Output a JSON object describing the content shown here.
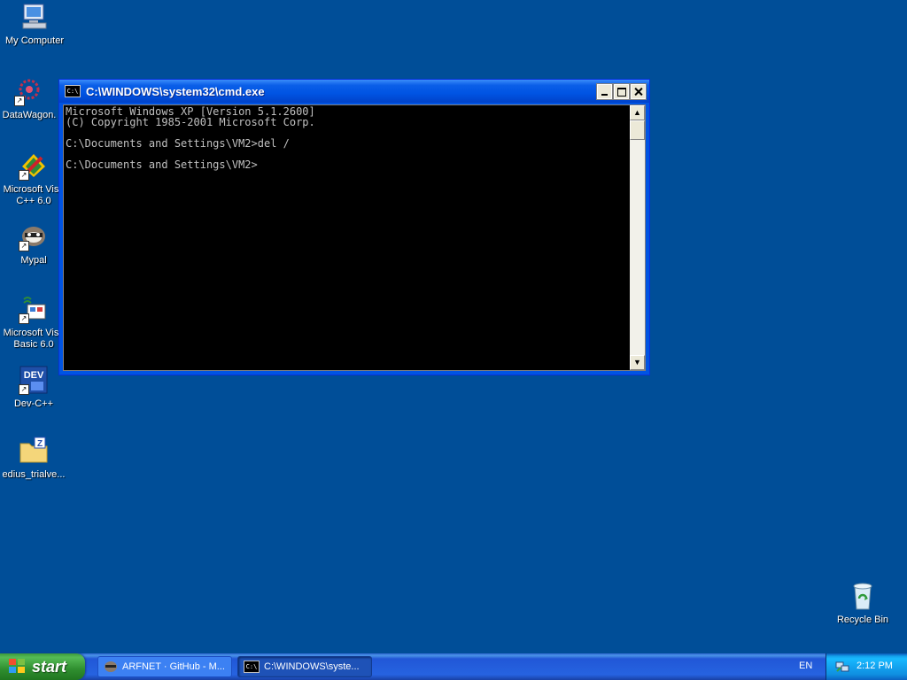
{
  "desktop": {
    "icons": [
      {
        "label": "My Computer",
        "icon": "my-computer-icon"
      },
      {
        "label": "DataWagon.",
        "icon": "datawagon-icon"
      },
      {
        "label": "Microsoft Visu\nC++ 6.0",
        "icon": "visual-cpp-icon"
      },
      {
        "label": "Mypal",
        "icon": "mypal-icon"
      },
      {
        "label": "Microsoft Visu\nBasic 6.0",
        "icon": "visual-basic-icon"
      },
      {
        "label": "Dev-C++",
        "icon": "dev-cpp-icon"
      },
      {
        "label": "edius_trialve...",
        "icon": "zip-folder-icon"
      },
      {
        "label": "Recycle Bin",
        "icon": "recycle-bin-icon"
      }
    ],
    "background": "#004e98"
  },
  "window": {
    "title": "C:\\WINDOWS\\system32\\cmd.exe",
    "icon_text": "C:\\",
    "console_lines": [
      "Microsoft Windows XP [Version 5.1.2600]",
      "(C) Copyright 1985-2001 Microsoft Corp.",
      "",
      "C:\\Documents and Settings\\VM2>del /",
      "",
      "C:\\Documents and Settings\\VM2>"
    ]
  },
  "taskbar": {
    "start_label": "start",
    "tasks": [
      {
        "label": "ARFNET · GitHub - M...",
        "icon": "mypal-icon"
      },
      {
        "label": "C:\\WINDOWS\\syste...",
        "icon": "cmd-icon"
      }
    ],
    "language": "EN",
    "clock": "2:12 PM"
  }
}
